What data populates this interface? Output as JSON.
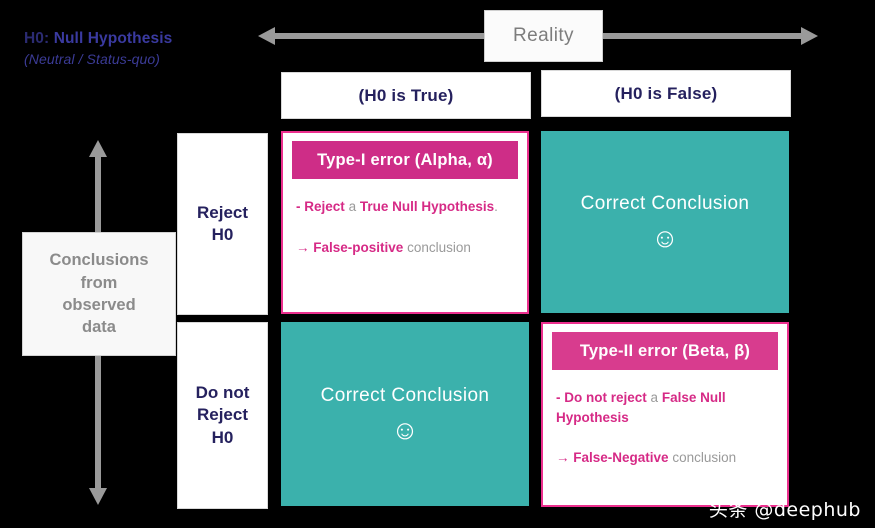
{
  "legend": {
    "h0_label": "H0:",
    "h0_title": " Null Hypothesis",
    "h0_subtitle": "(Neutral / Status-quo)"
  },
  "axes": {
    "reality_label": "Reality",
    "conclusions_line1": "Conclusions",
    "conclusions_line2": "from",
    "conclusions_line3": "observed",
    "conclusions_line4": "data"
  },
  "columns": [
    {
      "label": "(H0 is True)"
    },
    {
      "label": "(H0 is False)"
    }
  ],
  "rows": [
    {
      "line1": "Reject",
      "line2": "H0"
    },
    {
      "line1": "Do not",
      "line2": "Reject",
      "line3": "H0"
    }
  ],
  "cells": {
    "type1": {
      "header": "Type-I error (Alpha, α)",
      "bullet_marker": "-",
      "bullet_bold1": "Reject",
      "bullet_plain": "a",
      "bullet_bold2": "True Null Hypothesis",
      "bullet_period": ".",
      "arrow_marker": "→",
      "arrow_bold": "False-positive",
      "arrow_plain": "conclusion"
    },
    "correct_top_right": {
      "text": "Correct Conclusion",
      "smiley": "☺"
    },
    "correct_bottom_left": {
      "text": "Correct Conclusion",
      "smiley": "☺"
    },
    "type2": {
      "header": "Type-II  error (Beta, β)",
      "bullet_marker": "-",
      "bullet_bold1": "Do not reject",
      "bullet_plain": "a",
      "bullet_bold2": "False Null Hypothesis",
      "bullet_period": "",
      "arrow_marker": "→",
      "arrow_bold": "False-Negative",
      "arrow_plain": "conclusion"
    }
  },
  "watermark": {
    "text": "头条 @deephub"
  },
  "colors": {
    "background": "#000000",
    "teal": "#3bb1ac",
    "pink_type1": "#ce2d87",
    "pink_type2": "#d83c8e",
    "pink_border": "#ec2f8e",
    "pink_text": "#d62a86",
    "navy_text": "#25215e",
    "gray_text": "#8b8b8b",
    "arrow_gray": "#9a9a9a"
  }
}
